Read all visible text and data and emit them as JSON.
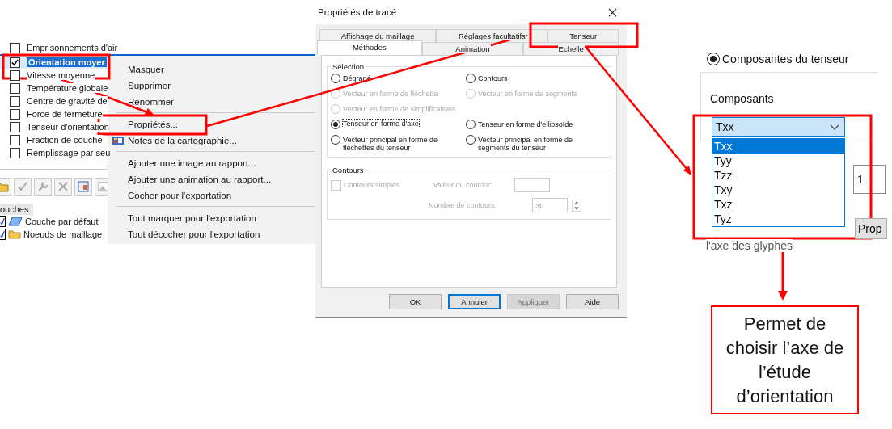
{
  "layers_list": {
    "items": [
      {
        "label": "Emprisonnements d'air",
        "checked": false,
        "selected": false
      },
      {
        "label": "Orientation moyer",
        "checked": true,
        "selected": true
      },
      {
        "label": "Vitesse moyenne",
        "checked": false,
        "selected": false
      },
      {
        "label": "Température globale",
        "checked": false,
        "selected": false
      },
      {
        "label": "Centre de gravité de",
        "checked": false,
        "selected": false
      },
      {
        "label": "Force de fermeture",
        "checked": false,
        "selected": false
      },
      {
        "label": "Tenseur d'orientation",
        "checked": false,
        "selected": false
      },
      {
        "label": "Fraction de couche",
        "checked": false,
        "selected": false
      },
      {
        "label": "Remplissage par seu",
        "checked": false,
        "selected": false
      }
    ]
  },
  "context_menu": {
    "groups": [
      [
        {
          "label": "Masquer",
          "kind": "plain"
        },
        {
          "label": "Supprimer",
          "kind": "plain"
        },
        {
          "label": "Renommer",
          "kind": "plain"
        }
      ],
      [
        {
          "label": "Propriétés...",
          "kind": "plain"
        },
        {
          "label": "Notes de la cartographie...",
          "kind": "icon"
        }
      ],
      [
        {
          "label": "Ajouter une image au rapport...",
          "kind": "plain"
        },
        {
          "label": "Ajouter une animation au rapport...",
          "kind": "plain"
        },
        {
          "label": "Cocher pour l'exportation",
          "kind": "plain"
        }
      ],
      [
        {
          "label": "Tout marquer pour l'exportation",
          "kind": "plain"
        },
        {
          "label": "Tout décocher pour l'exportation",
          "kind": "plain"
        }
      ]
    ]
  },
  "layers_panel": {
    "tab": "ouches",
    "items": [
      {
        "label": "Couche par défaut",
        "kind": "layer",
        "checked": true
      },
      {
        "label": "Noeuds de maillage",
        "kind": "folder",
        "checked": true
      }
    ]
  },
  "dialog": {
    "title": "Propriétés de tracé",
    "tab_rows": [
      [
        {
          "label": "Affichage du maillage",
          "selected": false
        },
        {
          "label": "Réglages facultatifs",
          "selected": false
        },
        {
          "label": "Tenseur",
          "selected": false
        }
      ],
      [
        {
          "label": "Méthodes",
          "selected": true
        },
        {
          "label": "Animation",
          "selected": false
        },
        {
          "label": "Echelle",
          "selected": false
        }
      ]
    ],
    "selection": {
      "title": "Sélection",
      "options": [
        {
          "label": "Dégradé",
          "kind": "cell",
          "selected": false,
          "disabled": false
        },
        {
          "label": "Contours",
          "kind": "cell",
          "selected": false,
          "disabled": false
        },
        {
          "label": "Vecteur en forme de fléchette",
          "kind": "cell",
          "selected": false,
          "disabled": true
        },
        {
          "label": "Vecteur en forme de segments",
          "kind": "cell",
          "selected": false,
          "disabled": true
        },
        {
          "label": "Vecteur en forme de simplifications",
          "kind": "wide",
          "selected": false,
          "disabled": true
        },
        {
          "label": "Tenseur en forme d'axe",
          "kind": "cell",
          "selected": true,
          "disabled": false
        },
        {
          "label": "Tenseur en forme d'ellipsoïde",
          "kind": "cell",
          "selected": false,
          "disabled": false
        },
        {
          "label": "Vecteur principal en forme de fléchettes du tenseur",
          "kind": "cell",
          "selected": false,
          "disabled": false
        },
        {
          "label": "Vecteur principal en forme de segments du tenseur",
          "kind": "cell",
          "selected": false,
          "disabled": false
        }
      ]
    },
    "contours": {
      "title": "Contours",
      "checkbox": {
        "label": "Contours simples",
        "checked": false,
        "disabled": true
      },
      "value_label": "Valeur du contour:",
      "count_label": "Nombre de contours:",
      "count": "30"
    },
    "buttons": [
      {
        "label": "OK",
        "focused": false,
        "disabled": false
      },
      {
        "label": "Annuler",
        "focused": true,
        "disabled": false
      },
      {
        "label": "Appliquer",
        "focused": false,
        "disabled": true
      },
      {
        "label": "Aide",
        "focused": false,
        "disabled": false
      }
    ]
  },
  "tensor_panel": {
    "radio": {
      "label": "Composantes du tenseur",
      "selected": true
    },
    "group_label": "Composants",
    "combo": {
      "value": "Txx",
      "options": [
        {
          "label": "Txx",
          "selected": true
        },
        {
          "label": "Tyy",
          "selected": false
        },
        {
          "label": "Tzz",
          "selected": false
        },
        {
          "label": "Txy",
          "selected": false
        },
        {
          "label": "Txz",
          "selected": false
        },
        {
          "label": "Tyz",
          "selected": false
        }
      ]
    },
    "field_value": "1",
    "caption": "l'axe des glyphes",
    "button": "Prop"
  },
  "callout": {
    "text": "Permet de choisir l’axe de l’étude d’orientation"
  }
}
